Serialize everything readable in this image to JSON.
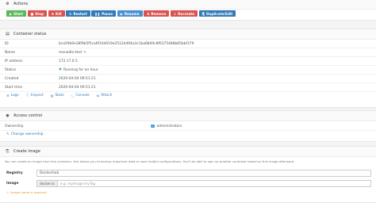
{
  "actions": {
    "title": "Actions",
    "buttons": [
      {
        "icon": "play-icon",
        "glyph": "▶",
        "label": "Start",
        "color": "#5cb85c"
      },
      {
        "icon": "stop-icon",
        "glyph": "■",
        "label": "Stop",
        "color": "#d9534f"
      },
      {
        "icon": "bomb-icon",
        "glyph": "✸",
        "label": "Kill",
        "color": "#d9534f"
      },
      {
        "icon": "refresh-icon",
        "glyph": "↻",
        "label": "Restart",
        "color": "#337ab7"
      },
      {
        "icon": "pause-icon",
        "glyph": "❚❚",
        "label": "Pause",
        "color": "#337ab7"
      },
      {
        "icon": "play-icon",
        "glyph": "▶",
        "label": "Resume",
        "color": "#4c8fcf"
      },
      {
        "icon": "trash-icon",
        "glyph": "✖",
        "label": "Remove",
        "color": "#d9534f"
      },
      {
        "icon": "cloud-download-icon",
        "glyph": "⇩",
        "label": "Recreate",
        "color": "#d9534f"
      },
      {
        "icon": "copy-icon",
        "glyph": "⎘",
        "label": "Duplicate/Edit",
        "color": "#337ab7"
      }
    ]
  },
  "status": {
    "title": "Container status",
    "rows": [
      {
        "key": "ID",
        "value": "bca59b9e38f9b5f5ca6f16d019e2512d494a3c1ba68d9c8f6375488b85bbf379"
      },
      {
        "key": "Name",
        "value": "manadlo-test"
      },
      {
        "key": "IP address",
        "value": "172.17.0.5"
      },
      {
        "key": "Status",
        "value": "Running for an hour"
      },
      {
        "key": "Created",
        "value": "2020-04-04 09:51:21"
      },
      {
        "key": "Start time",
        "value": "2020-04-04 09:51:21"
      }
    ],
    "links": [
      {
        "icon": "file-icon",
        "glyph": "☰",
        "label": "Logs"
      },
      {
        "icon": "info-icon",
        "glyph": "ⓘ",
        "label": "Inspect"
      },
      {
        "icon": "chart-icon",
        "glyph": "▤",
        "label": "Stats"
      },
      {
        "icon": "terminal-icon",
        "glyph": "›_",
        "label": "Console"
      },
      {
        "icon": "plug-icon",
        "glyph": "⇆",
        "label": "Attach"
      }
    ]
  },
  "access": {
    "title": "Access control",
    "ownership_label": "Ownership",
    "ownership_value": "administrators",
    "change_label": "Change ownership"
  },
  "create_image": {
    "title": "Create image",
    "hint": "You can create an image from this container, this allows you to backup important data or save helpful configurations. You'll be able to spin up another container based on this image afterward.",
    "registry_label": "Registry",
    "registry_value": "DockerHub",
    "image_label": "Image",
    "image_prefix": "docker.io",
    "image_placeholder": "e.g. myImage:myTag",
    "required_msg": "Image name is required."
  }
}
